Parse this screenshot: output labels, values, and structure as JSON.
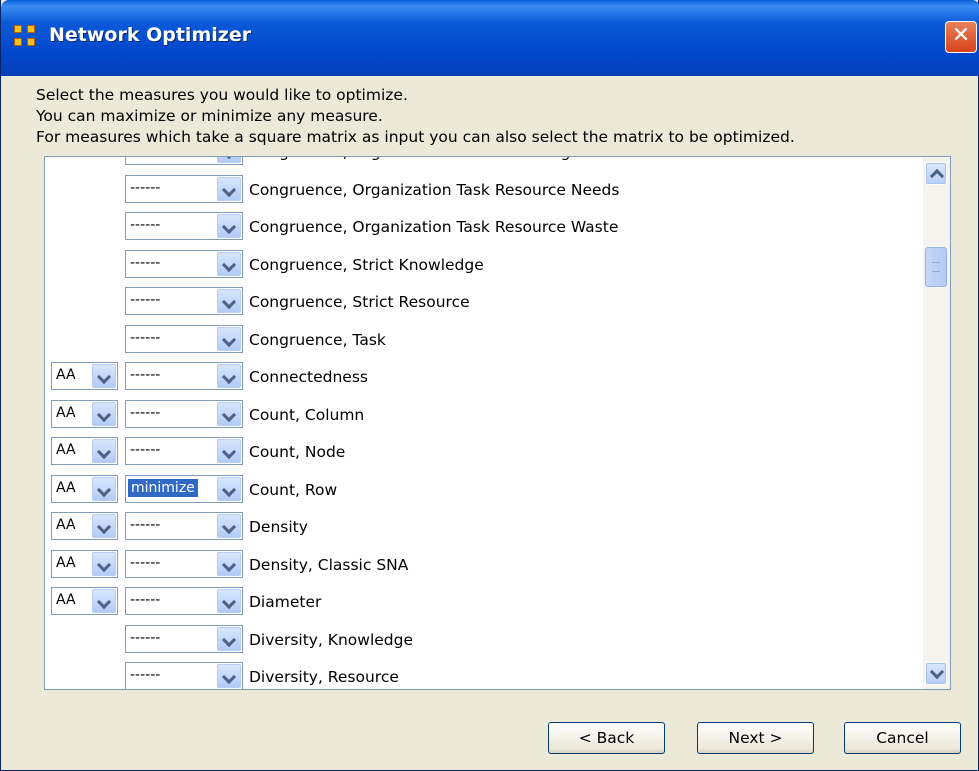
{
  "window": {
    "title": "Network Optimizer",
    "close_glyph": "✕"
  },
  "instructions": [
    "Select the measures you would like to optimize.",
    "You can maximize or minimize any measure.",
    "For measures which take a square matrix as input you can also select the matrix to be optimized."
  ],
  "measures": [
    {
      "matrix": "",
      "goal": "------",
      "label": "Congruence, Organization Task Knowledge Waste"
    },
    {
      "matrix": "",
      "goal": "------",
      "label": "Congruence, Organization Task Resource Needs"
    },
    {
      "matrix": "",
      "goal": "------",
      "label": "Congruence, Organization Task Resource Waste"
    },
    {
      "matrix": "",
      "goal": "------",
      "label": "Congruence, Strict Knowledge"
    },
    {
      "matrix": "",
      "goal": "------",
      "label": "Congruence, Strict Resource"
    },
    {
      "matrix": "",
      "goal": "------",
      "label": "Congruence, Task"
    },
    {
      "matrix": "AA",
      "goal": "------",
      "label": "Connectedness"
    },
    {
      "matrix": "AA",
      "goal": "------",
      "label": "Count, Column"
    },
    {
      "matrix": "AA",
      "goal": "------",
      "label": "Count, Node"
    },
    {
      "matrix": "AA",
      "goal": "minimize",
      "label": "Count, Row",
      "selected": true
    },
    {
      "matrix": "AA",
      "goal": "------",
      "label": "Density"
    },
    {
      "matrix": "AA",
      "goal": "------",
      "label": "Density, Classic SNA"
    },
    {
      "matrix": "AA",
      "goal": "------",
      "label": "Diameter"
    },
    {
      "matrix": "",
      "goal": "------",
      "label": "Diversity, Knowledge"
    },
    {
      "matrix": "",
      "goal": "------",
      "label": "Diversity, Resource"
    }
  ],
  "buttons": {
    "back": "< Back",
    "next": "Next >",
    "cancel": "Cancel"
  },
  "colors": {
    "titlebar": "#0147cc",
    "selection": "#316ac5",
    "dialog_bg": "#ece9d8"
  }
}
